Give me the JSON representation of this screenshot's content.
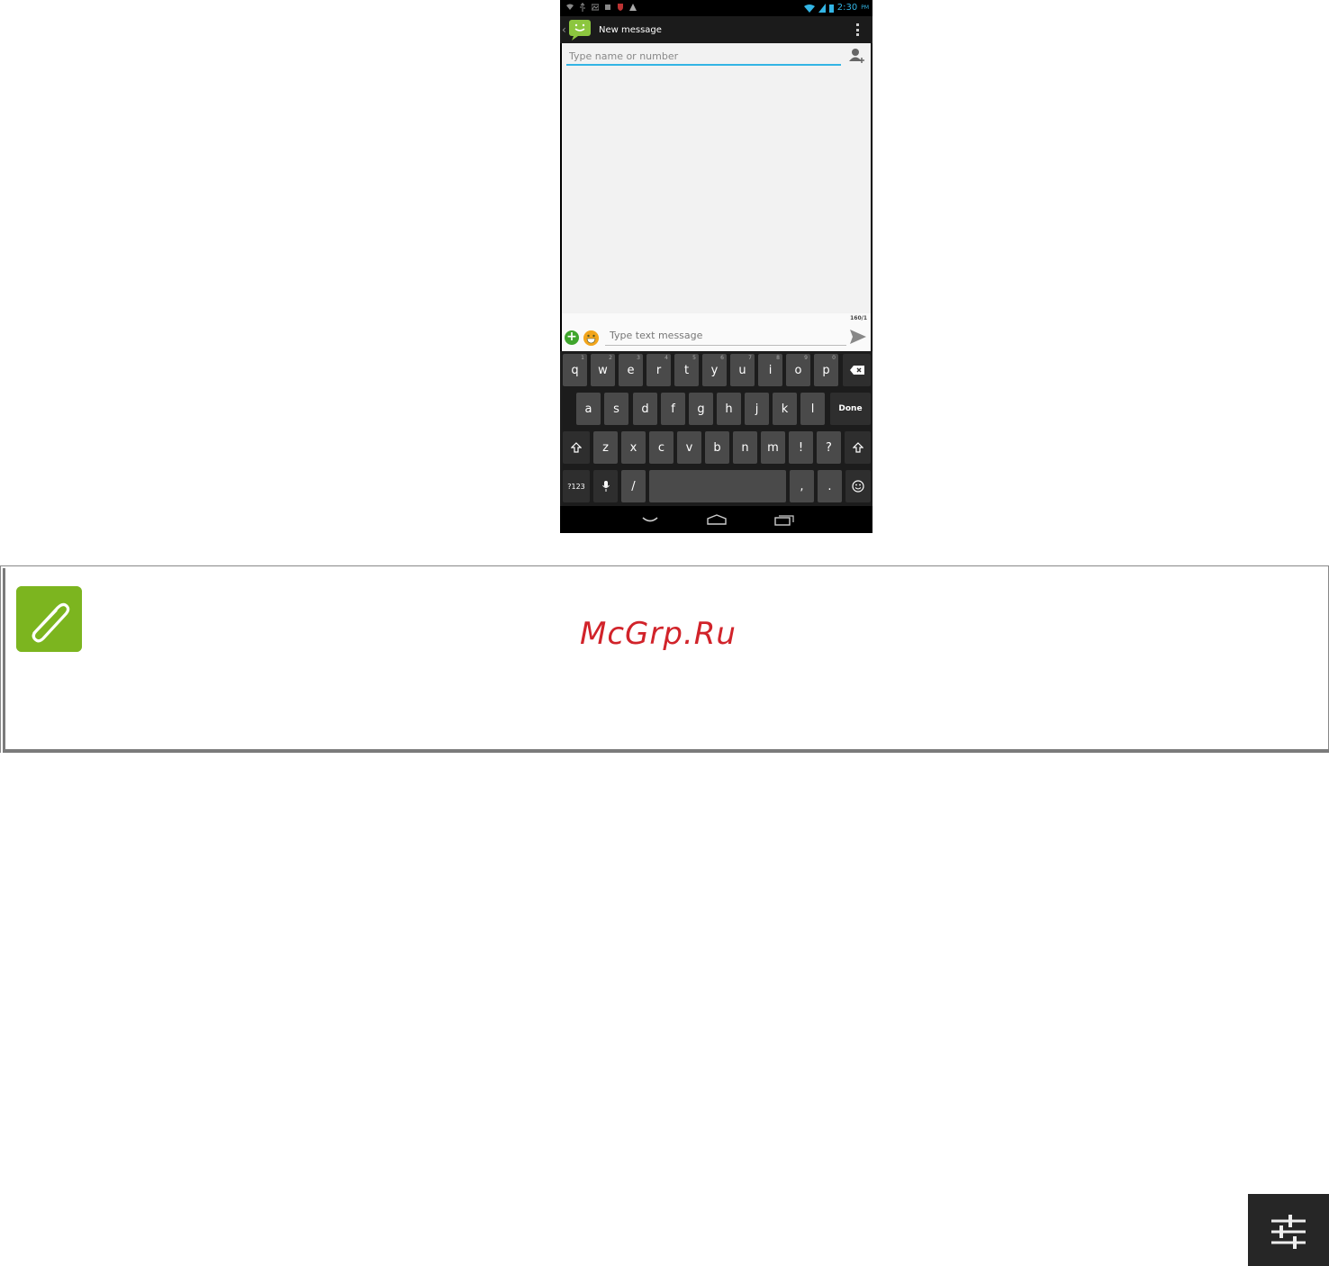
{
  "status_bar": {
    "time": "2:30",
    "ampm": "PM"
  },
  "action_bar": {
    "title": "New message"
  },
  "recipient": {
    "placeholder": "Type name or number"
  },
  "compose": {
    "counter": "160/1",
    "placeholder": "Type text message"
  },
  "keyboard": {
    "row1": [
      {
        "label": "q",
        "sub": "1"
      },
      {
        "label": "w",
        "sub": "2"
      },
      {
        "label": "e",
        "sub": "3"
      },
      {
        "label": "r",
        "sub": "4"
      },
      {
        "label": "t",
        "sub": "5"
      },
      {
        "label": "y",
        "sub": "6"
      },
      {
        "label": "u",
        "sub": "7"
      },
      {
        "label": "i",
        "sub": "8"
      },
      {
        "label": "o",
        "sub": "9"
      },
      {
        "label": "p",
        "sub": "0"
      }
    ],
    "row2": [
      "a",
      "s",
      "d",
      "f",
      "g",
      "h",
      "j",
      "k",
      "l"
    ],
    "done_label": "Done",
    "row3": [
      "z",
      "x",
      "c",
      "v",
      "b",
      "n",
      "m",
      "!",
      "?"
    ],
    "symbols_label": "?123",
    "slash_label": "/",
    "comma_label": ",",
    "period_label": "."
  },
  "watermark": {
    "text": "McGrp.Ru"
  },
  "icons": {
    "app": "messaging-icon",
    "note": "paperclip-icon",
    "fab": "settings-sliders-icon"
  },
  "colors": {
    "accent": "#33b5e5",
    "note_green": "#7cb51f",
    "watermark_red": "#d1232a"
  }
}
